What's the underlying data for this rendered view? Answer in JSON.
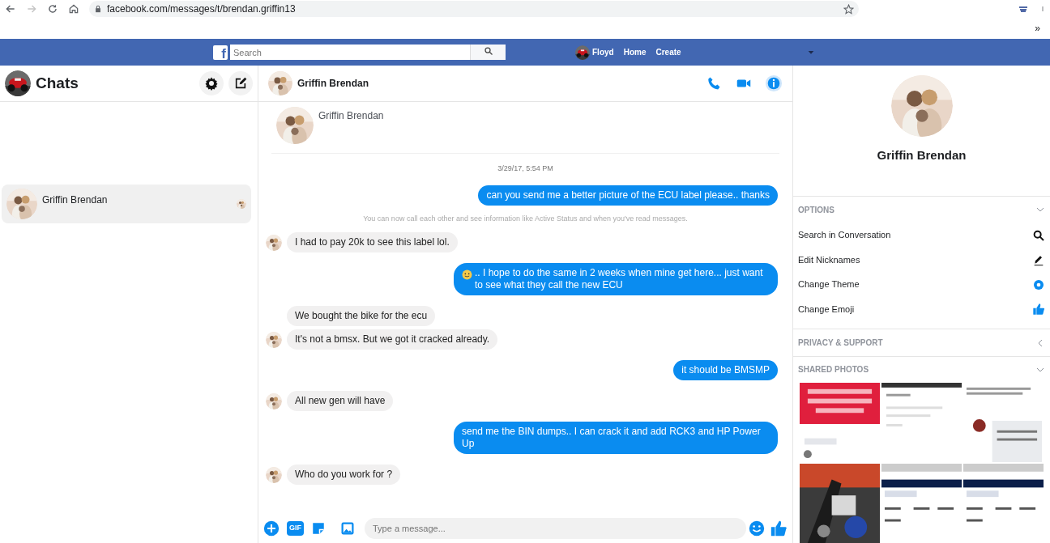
{
  "browser": {
    "url": "facebook.com/messages/t/brendan.griffin13",
    "forward_disabled": true,
    "overflow": "»"
  },
  "topbar": {
    "logo": "f",
    "search": {
      "placeholder": "Search"
    },
    "user": "Floyd",
    "links": [
      "Home",
      "Create"
    ]
  },
  "sidebar": {
    "title": "Chats",
    "conversations": [
      {
        "name": "Griffin Brendan",
        "selected": true
      }
    ]
  },
  "chat": {
    "contact": "Griffin Brendan",
    "profile_name": "Griffin Brendan",
    "messages": [
      {
        "kind": "timestamp",
        "text": "3/29/17, 5:54 PM"
      },
      {
        "kind": "outgoing",
        "text": "can you send me a better picture of the ECU label please.. thanks"
      },
      {
        "kind": "notice",
        "text": "You can now call each other and see information like Active Status and when you've read messages."
      },
      {
        "kind": "incoming",
        "text": "I had to pay 20k to see this label lol.",
        "avatar": true
      },
      {
        "kind": "outgoing",
        "text": ".. I hope to do the same in 2 weeks when mine get here... just want to see what they call the new ECU",
        "emoji": true
      },
      {
        "kind": "incoming",
        "text": "We bought the bike for the ecu",
        "avatar": false
      },
      {
        "kind": "incoming",
        "text": "It's not a bmsx.  But we got it cracked already.",
        "avatar": true
      },
      {
        "kind": "outgoing",
        "text": "it should be BMSMP"
      },
      {
        "kind": "incoming",
        "text": "All new gen will have",
        "avatar": true
      },
      {
        "kind": "outgoing",
        "text": "send me the BIN dumps.. I can crack it and add RCK3 and HP Power Up"
      },
      {
        "kind": "incoming",
        "text": "Who do you work for ?",
        "avatar": true
      }
    ],
    "composer": {
      "gif": "GIF",
      "placeholder": "Type a message..."
    }
  },
  "details": {
    "name": "Griffin Brendan",
    "sections": [
      {
        "title": "OPTIONS",
        "expanded": true,
        "items": [
          {
            "label": "Search in Conversation",
            "kind": "search"
          },
          {
            "label": "Edit Nicknames",
            "kind": "edit"
          },
          {
            "label": "Change Theme",
            "kind": "theme"
          },
          {
            "label": "Change Emoji",
            "kind": "emoji"
          }
        ]
      },
      {
        "title": "PRIVACY & SUPPORT",
        "expanded": false
      },
      {
        "title": "SHARED PHOTOS",
        "expanded": true
      }
    ]
  }
}
